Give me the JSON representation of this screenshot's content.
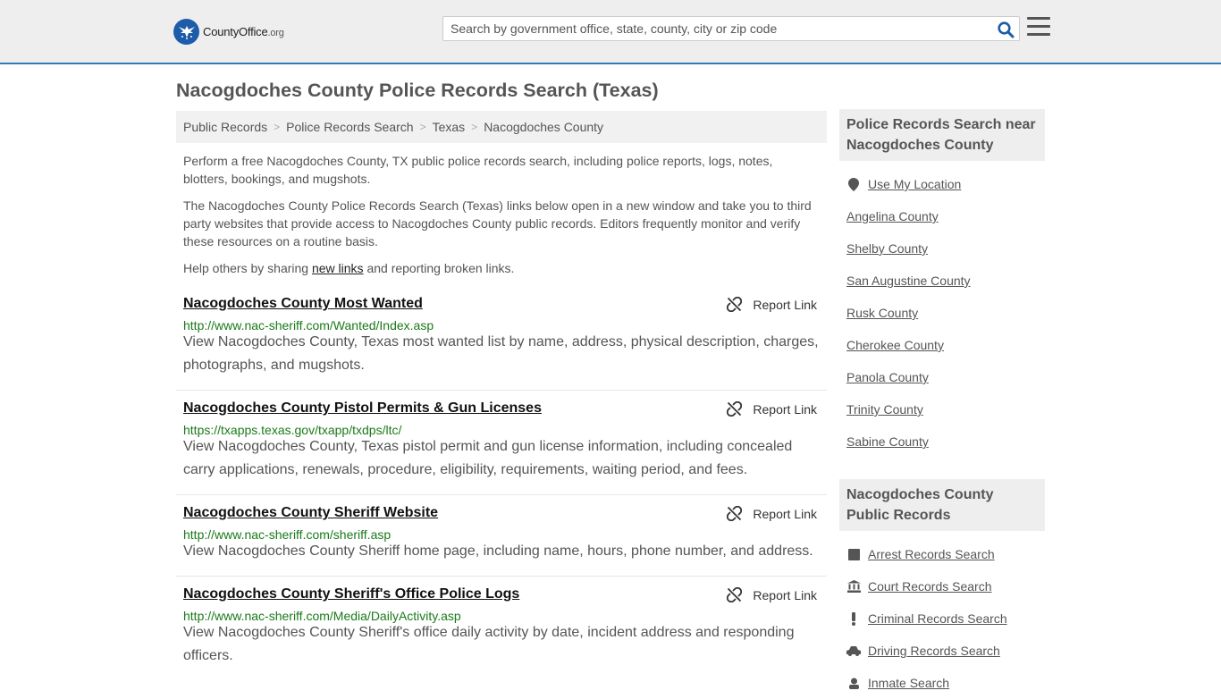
{
  "header": {
    "logo_name": "CountyOffice",
    "logo_suffix": ".org",
    "search_placeholder": "Search by government office, state, county, city or zip code"
  },
  "page_title": "Nacogdoches County Police Records Search (Texas)",
  "breadcrumb": [
    "Public Records",
    "Police Records Search",
    "Texas",
    "Nacogdoches County"
  ],
  "intro": {
    "p1": "Perform a free Nacogdoches County, TX public police records search, including police reports, logs, notes, blotters, bookings, and mugshots.",
    "p2": "The Nacogdoches County Police Records Search (Texas) links below open in a new window and take you to third party websites that provide access to Nacogdoches County public records. Editors frequently monitor and verify these resources on a routine basis.",
    "p3_before": "Help others by sharing ",
    "p3_link": "new links",
    "p3_after": " and reporting broken links."
  },
  "report_label": "Report Link",
  "listings": [
    {
      "title": "Nacogdoches County Most Wanted",
      "url": "http://www.nac-sheriff.com/Wanted/Index.asp",
      "desc": "View Nacogdoches County, Texas most wanted list by name, address, physical description, charges, photographs, and mugshots."
    },
    {
      "title": "Nacogdoches County Pistol Permits & Gun Licenses",
      "url": "https://txapps.texas.gov/txapp/txdps/ltc/",
      "desc": "View Nacogdoches County, Texas pistol permit and gun license information, including concealed carry applications, renewals, procedure, eligibility, requirements, waiting period, and fees."
    },
    {
      "title": "Nacogdoches County Sheriff Website",
      "url": "http://www.nac-sheriff.com/sheriff.asp",
      "desc": "View Nacogdoches County Sheriff home page, including name, hours, phone number, and address."
    },
    {
      "title": "Nacogdoches County Sheriff's Office Police Logs",
      "url": "http://www.nac-sheriff.com/Media/DailyActivity.asp",
      "desc": "View Nacogdoches County Sheriff's office daily activity by date, incident address and responding officers."
    }
  ],
  "sidebar": {
    "nearby_heading": "Police Records Search near Nacogdoches County",
    "use_location": "Use My Location",
    "nearby": [
      "Angelina County",
      "Shelby County",
      "San Augustine County",
      "Rusk County",
      "Cherokee County",
      "Panola County",
      "Trinity County",
      "Sabine County"
    ],
    "records_heading": "Nacogdoches County Public Records",
    "records": [
      {
        "label": "Arrest Records Search",
        "icon": "square-icon"
      },
      {
        "label": "Court Records Search",
        "icon": "courthouse-icon"
      },
      {
        "label": "Criminal Records Search",
        "icon": "exclamation-icon"
      },
      {
        "label": "Driving Records Search",
        "icon": "car-icon"
      },
      {
        "label": "Inmate Search",
        "icon": "inmate-icon"
      }
    ]
  }
}
